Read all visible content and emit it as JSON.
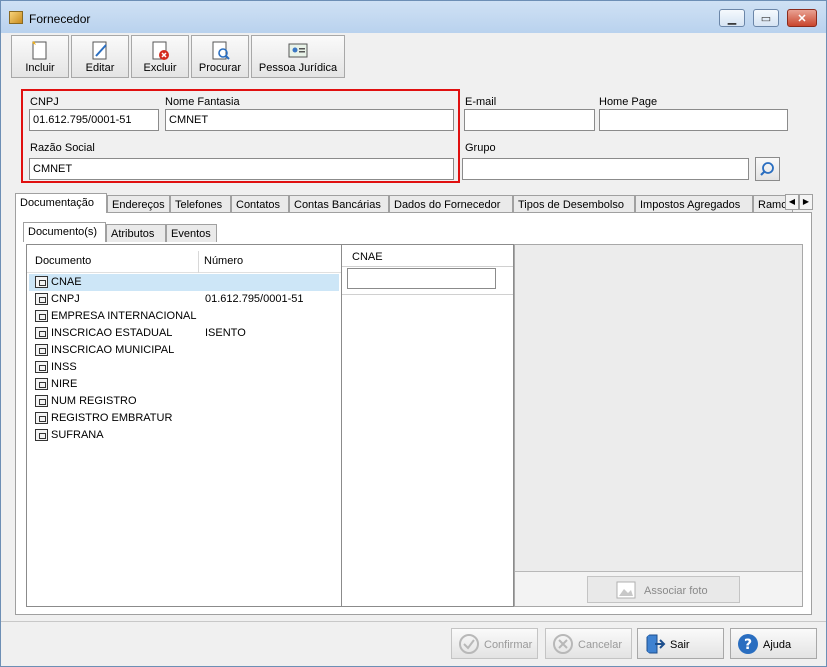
{
  "window": {
    "title": "Fornecedor"
  },
  "toolbar": {
    "buttons": [
      {
        "label": "Incluir",
        "icon": "new-document-icon"
      },
      {
        "label": "Editar",
        "icon": "edit-icon"
      },
      {
        "label": "Excluir",
        "icon": "delete-icon"
      },
      {
        "label": "Procurar",
        "icon": "search-document-icon"
      },
      {
        "label": "Pessoa Jurídica",
        "icon": "company-card-icon"
      }
    ]
  },
  "form": {
    "cnpj_label": "CNPJ",
    "cnpj_value": "01.612.795/0001-51",
    "nome_fantasia_label": "Nome Fantasia",
    "nome_fantasia_value": "CMNET",
    "razao_social_label": "Razão Social",
    "razao_social_value": "CMNET",
    "email_label": "E-mail",
    "email_value": "",
    "home_page_label": "Home Page",
    "home_page_value": "",
    "grupo_label": "Grupo",
    "grupo_value": ""
  },
  "tabs": [
    "Documentação",
    "Endereços",
    "Telefones",
    "Contatos",
    "Contas Bancárias",
    "Dados do Fornecedor",
    "Tipos de Desembolso",
    "Impostos Agregados",
    "Ramo"
  ],
  "subtabs": [
    "Documento(s)",
    "Atributos",
    "Eventos"
  ],
  "documents": {
    "headers": {
      "documento": "Documento",
      "numero": "Número"
    },
    "rows": [
      {
        "documento": "CNAE",
        "numero": ""
      },
      {
        "documento": "CNPJ",
        "numero": "01.612.795/0001-51"
      },
      {
        "documento": "EMPRESA INTERNACIONAL",
        "numero": ""
      },
      {
        "documento": "INSCRICAO ESTADUAL",
        "numero": "ISENTO"
      },
      {
        "documento": "INSCRICAO MUNICIPAL",
        "numero": ""
      },
      {
        "documento": "INSS",
        "numero": ""
      },
      {
        "documento": "NIRE",
        "numero": ""
      },
      {
        "documento": "NUM REGISTRO",
        "numero": ""
      },
      {
        "documento": "REGISTRO EMBRATUR",
        "numero": ""
      },
      {
        "documento": "SUFRANA",
        "numero": ""
      }
    ]
  },
  "cnae": {
    "label": "CNAE",
    "value": ""
  },
  "photo": {
    "button_label": "Associar foto"
  },
  "footer": {
    "confirmar": "Confirmar",
    "cancelar": "Cancelar",
    "sair": "Sair",
    "ajuda": "Ajuda"
  }
}
